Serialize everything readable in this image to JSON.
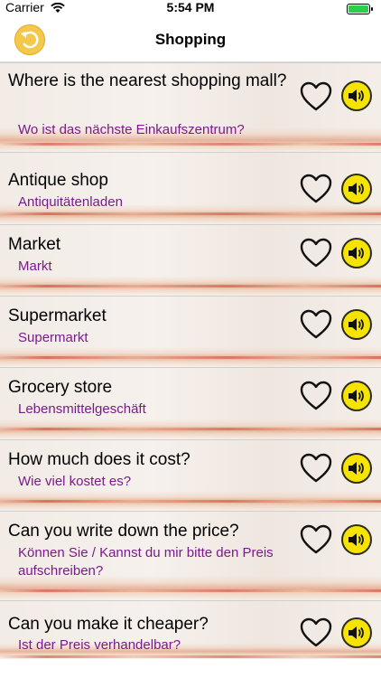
{
  "status_bar": {
    "carrier": "Carrier",
    "time": "5:54 PM"
  },
  "nav": {
    "title": "Shopping"
  },
  "phrases": [
    {
      "en": "Where is the nearest shopping mall?",
      "de": "Wo ist das nächste Einkaufszentrum?"
    },
    {
      "en": "Antique shop",
      "de": "Antiquitätenladen"
    },
    {
      "en": "Market",
      "de": "Markt"
    },
    {
      "en": "Supermarket",
      "de": "Supermarkt"
    },
    {
      "en": "Grocery store",
      "de": "Lebensmittelgeschäft"
    },
    {
      "en": "How much does it cost?",
      "de": "Wie viel kostet es?"
    },
    {
      "en": "Can you write down the price?",
      "de": "Können Sie / Kannst du mir bitte den Preis aufschreiben?"
    },
    {
      "en": "Can you make it cheaper?",
      "de": "Ist der Preis verhandelbar?"
    }
  ],
  "colors": {
    "translation": "#7a1a8c",
    "speaker": "#f6e400",
    "back_button": "#f4c84a"
  },
  "icons": {
    "row_favorite": "heart-icon",
    "row_audio": "speaker-icon",
    "back": "back-icon"
  }
}
